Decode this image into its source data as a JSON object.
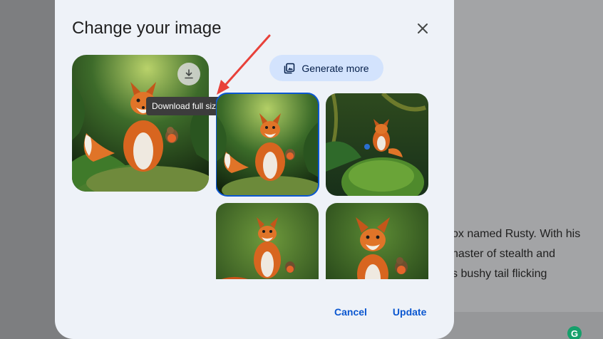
{
  "background_document": {
    "lines": [
      "ox named Rusty. With his",
      "naster of stealth and",
      "s bushy tail flicking"
    ]
  },
  "dialog": {
    "title": "Change your image",
    "close_icon": "close-icon",
    "download_icon": "download-icon",
    "tooltip": "Download full size",
    "generate_more": {
      "label": "Generate more",
      "icon": "image-stack-icon"
    },
    "images": [
      {
        "alt": "fox-on-mossy-rock-with-robin",
        "selected": true
      },
      {
        "alt": "fox-on-mossy-boulder-with-bluebird",
        "selected": false
      },
      {
        "alt": "fox-sitting-with-robin",
        "selected": false
      },
      {
        "alt": "fox-portrait-with-robin",
        "selected": false
      }
    ],
    "actions": {
      "cancel": "Cancel",
      "update": "Update"
    }
  },
  "colors": {
    "dialog_bg": "#eef2f8",
    "accent": "#0b57d0",
    "chip_bg": "#d3e3fd",
    "annotation_arrow": "#e8413a"
  }
}
